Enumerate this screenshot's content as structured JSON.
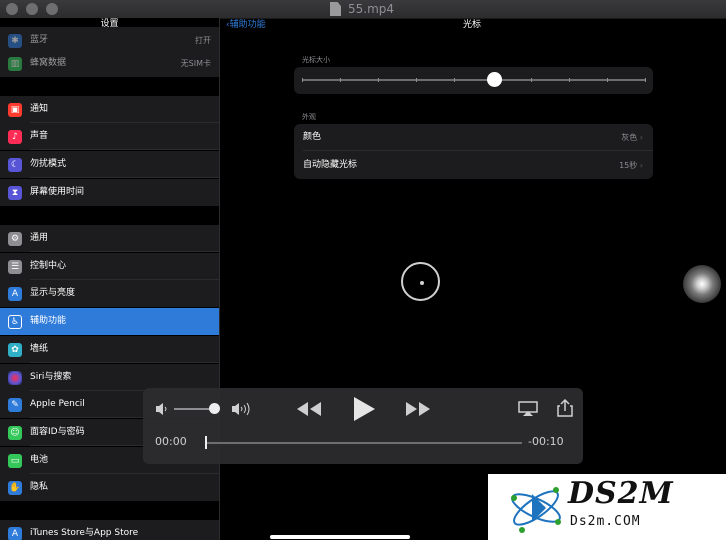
{
  "window": {
    "title": "55.mp4"
  },
  "sidebar": {
    "title": "设置",
    "top_rows": [
      {
        "icon": "wifi-icon",
        "label": "蓝牙",
        "value": "打开",
        "color": "#2f7bd9"
      },
      {
        "icon": "cellular-icon",
        "label": "蜂窝数据",
        "value": "无SIM卡",
        "color": "#34c759"
      }
    ],
    "group2": [
      {
        "icon": "notification-icon",
        "label": "通知",
        "color": "#ff3b30"
      },
      {
        "icon": "sound-icon",
        "label": "声音",
        "color": "#ff2d55"
      },
      {
        "icon": "moon-icon",
        "label": "勿扰模式",
        "color": "#5856d6"
      },
      {
        "icon": "hourglass-icon",
        "label": "屏幕使用时间",
        "color": "#5856d6"
      }
    ],
    "group3": [
      {
        "icon": "gear-icon",
        "label": "通用",
        "color": "#8e8e93"
      },
      {
        "icon": "switches-icon",
        "label": "控制中心",
        "color": "#8e8e93"
      },
      {
        "icon": "brightness-icon",
        "label": "显示与亮度",
        "color": "#2f7bd9"
      },
      {
        "icon": "accessibility-icon",
        "label": "辅助功能",
        "color": "#2f7bd9",
        "active": true
      },
      {
        "icon": "flower-icon",
        "label": "墙纸",
        "color": "#30b0c7"
      },
      {
        "icon": "siri-icon",
        "label": "Siri与搜索",
        "color": "#222"
      },
      {
        "icon": "pencil-icon",
        "label": "Apple Pencil",
        "color": "#2f7bd9"
      },
      {
        "icon": "faceid-icon",
        "label": "面容ID与密码",
        "color": "#34c759"
      },
      {
        "icon": "battery-icon",
        "label": "电池",
        "color": "#34c759"
      },
      {
        "icon": "hand-icon",
        "label": "隐私",
        "color": "#2f7bd9"
      }
    ],
    "group4": [
      {
        "icon": "appstore-icon",
        "label": "iTunes Store与App Store",
        "color": "#2f7bd9"
      }
    ]
  },
  "detail": {
    "back_label": "辅助功能",
    "title": "光标",
    "size_section": "光标大小",
    "size_value": 0.56,
    "appearance_section": "外观",
    "options": [
      {
        "label": "颜色",
        "value": "灰色"
      },
      {
        "label": "自动隐藏光标",
        "value": "15秒"
      }
    ]
  },
  "player": {
    "current_time": "00:00",
    "remaining_time": "-00:10",
    "volume": 0.88,
    "progress": 0.0
  },
  "watermark": {
    "logo": "DS2M",
    "site": "Ds2m.COM"
  }
}
